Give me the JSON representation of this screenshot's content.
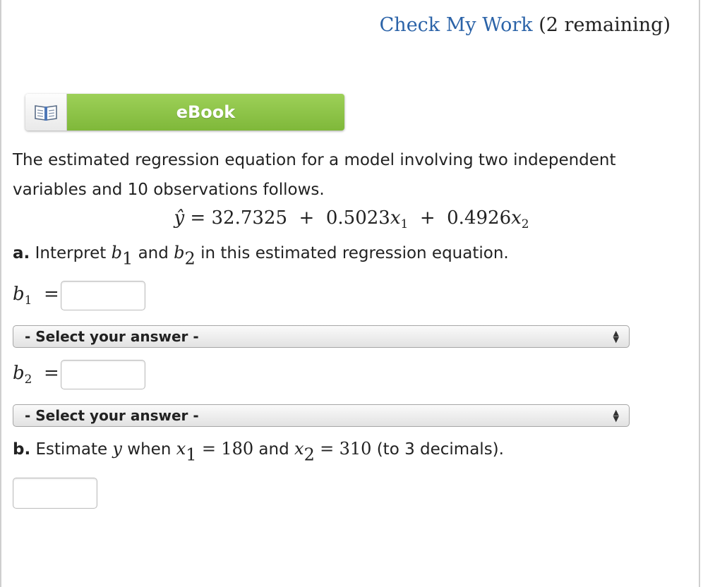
{
  "header": {
    "check_link": "Check My Work",
    "remaining": "(2 remaining)"
  },
  "ebook": {
    "label": "eBook",
    "icon": "book-icon"
  },
  "intro": {
    "text": "The estimated regression equation for a model involving two independent variables and 10 observations follows."
  },
  "equation": {
    "yhat": "ŷ",
    "equals": "=",
    "intercept": "32.7325",
    "plus1": "+",
    "coef1": "0.5023",
    "x1": "x",
    "x1_sub": "1",
    "plus2": "+",
    "coef2": "0.4926",
    "x2": "x",
    "x2_sub": "2"
  },
  "part_a": {
    "label": "a.",
    "text_before": "Interpret",
    "b1": "b",
    "b1_sub": "1",
    "and": "and",
    "b2": "b",
    "b2_sub": "2",
    "text_after": "in this estimated regression equation."
  },
  "b1_field": {
    "var": "b",
    "sub": "1",
    "equals": "=",
    "value": ""
  },
  "b1_select": {
    "selected": "- Select your answer -"
  },
  "b2_field": {
    "var": "b",
    "sub": "2",
    "equals": "=",
    "value": ""
  },
  "b2_select": {
    "selected": "- Select your answer -"
  },
  "part_b": {
    "label": "b.",
    "text1": "Estimate",
    "y": "y",
    "text2": "when",
    "x1": "x",
    "x1_sub": "1",
    "eq1": "=",
    "val1": "180",
    "and": "and",
    "x2": "x",
    "x2_sub": "2",
    "eq2": "=",
    "val2": "310",
    "text3": "(to 3 decimals)."
  },
  "estimate_field": {
    "value": ""
  }
}
